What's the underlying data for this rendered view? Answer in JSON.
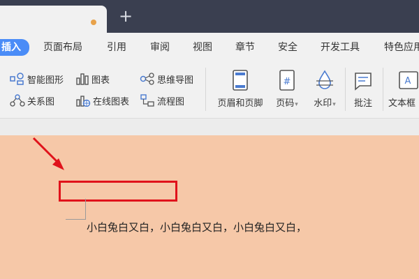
{
  "tabbar": {
    "new_tab_symbol": "+"
  },
  "menu": [
    {
      "label": "插入",
      "active": true
    },
    {
      "label": "页面布局"
    },
    {
      "label": "引用"
    },
    {
      "label": "审阅"
    },
    {
      "label": "视图"
    },
    {
      "label": "章节"
    },
    {
      "label": "安全"
    },
    {
      "label": "开发工具"
    },
    {
      "label": "特色应用"
    }
  ],
  "ribbon": {
    "smart_art": "智能图形",
    "chart": "图表",
    "mind_map": "思维导图",
    "relation_map": "关系图",
    "online_chart": "在线图表",
    "flowchart": "流程图",
    "header_footer": "页眉和页脚",
    "page_number": "页码",
    "watermark": "水印",
    "comment": "批注",
    "textbox": "文本框"
  },
  "document": {
    "body_text": "小白兔白又白，小白兔白又白，小白兔白又白，"
  },
  "annotations": {
    "highlight_color": "#e0121b",
    "accent_color": "#4a8cf7",
    "page_color": "#f6c8a8"
  }
}
